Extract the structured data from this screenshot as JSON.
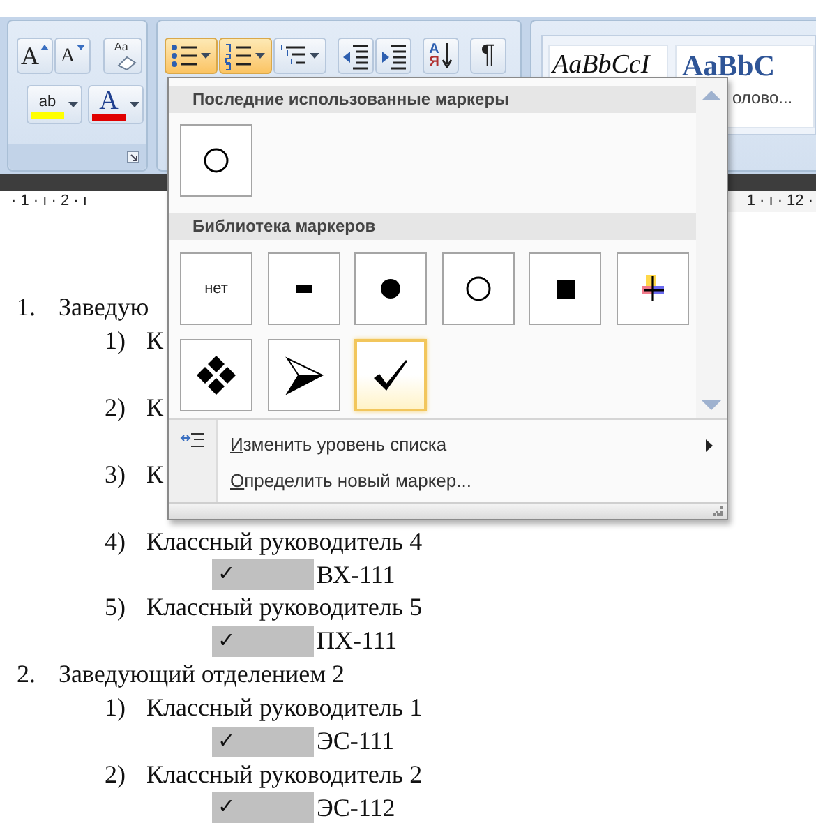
{
  "ribbon": {
    "font_group": {
      "row_1": [
        {
          "kind": "grow-font",
          "glyph": "A"
        },
        {
          "kind": "shrink-font",
          "glyph": "A"
        },
        {
          "kind": "clear-format",
          "glyph": "Aa"
        }
      ],
      "row_2": [
        {
          "kind": "highlight",
          "glyph": "ab"
        },
        {
          "kind": "font-color",
          "glyph": "A"
        }
      ]
    },
    "paragraph_group": {
      "clusters": [
        [
          {
            "kind": "bullets",
            "pressed": true
          },
          {
            "kind": "numbering",
            "pressed": true
          },
          {
            "kind": "multilevel",
            "pressed": false
          }
        ],
        [
          {
            "kind": "decrease-indent",
            "pressed": false
          },
          {
            "kind": "increase-indent",
            "pressed": false
          }
        ],
        [
          {
            "kind": "sort",
            "pressed": false,
            "glyphs": [
              "A",
              "Я"
            ]
          }
        ],
        [
          {
            "kind": "pilcrow",
            "pressed": false,
            "glyph": "¶"
          }
        ]
      ]
    },
    "styles": [
      {
        "kind": "normal",
        "preview": "AaBbCcI"
      },
      {
        "kind": "heading",
        "preview": "AaBbC",
        "label": "олово..."
      }
    ]
  },
  "ruler": {
    "left": "· 1 · ı · 2 · ı",
    "right": "1 · ı · 12 ·"
  },
  "bullet_menu": {
    "sections": [
      {
        "title": "Последние использованные маркеры",
        "markers": [
          {
            "kind": "circle",
            "selected": false
          }
        ]
      },
      {
        "title": "Библиотека маркеров",
        "markers": [
          {
            "kind": "none",
            "label": "нет",
            "selected": false
          },
          {
            "kind": "dash",
            "selected": false
          },
          {
            "kind": "dot",
            "selected": false
          },
          {
            "kind": "circle",
            "selected": false
          },
          {
            "kind": "square",
            "selected": false
          },
          {
            "kind": "cross",
            "selected": false
          },
          {
            "kind": "diamonds",
            "selected": false
          },
          {
            "kind": "arrowhead",
            "selected": false
          },
          {
            "kind": "check",
            "selected": true
          }
        ]
      }
    ],
    "menu": [
      {
        "icon": true,
        "label": "Изменить уровень списка",
        "submenu": true
      },
      {
        "icon": false,
        "label": "Определить новый маркер...",
        "submenu": false
      }
    ]
  },
  "document": {
    "items": [
      {
        "kind": "level1",
        "number": "1.",
        "text": "Заведую"
      },
      {
        "kind": "level2",
        "number": "1)",
        "text": "К"
      },
      {
        "kind": "level2",
        "number": "2)",
        "text": "К"
      },
      {
        "kind": "level2",
        "number": "3)",
        "text": "К"
      },
      {
        "kind": "level2",
        "number": "4)",
        "text": "Классный руководитель 4"
      },
      {
        "kind": "bullet",
        "marker": "✓",
        "text": "ВХ-111"
      },
      {
        "kind": "level2",
        "number": "5)",
        "text": "Классный руководитель 5"
      },
      {
        "kind": "bullet",
        "marker": "✓",
        "text": "ПХ-111"
      },
      {
        "kind": "level1",
        "number": "2.",
        "text": "Заведующий отделением 2"
      },
      {
        "kind": "level2",
        "number": "1)",
        "text": "Классный руководитель 1"
      },
      {
        "kind": "bullet",
        "marker": "✓",
        "text": "ЭС-111"
      },
      {
        "kind": "level2",
        "number": "2)",
        "text": "Классный руководитель 2"
      },
      {
        "kind": "bullet",
        "marker": "✓",
        "text": "ЭС-112"
      }
    ]
  }
}
